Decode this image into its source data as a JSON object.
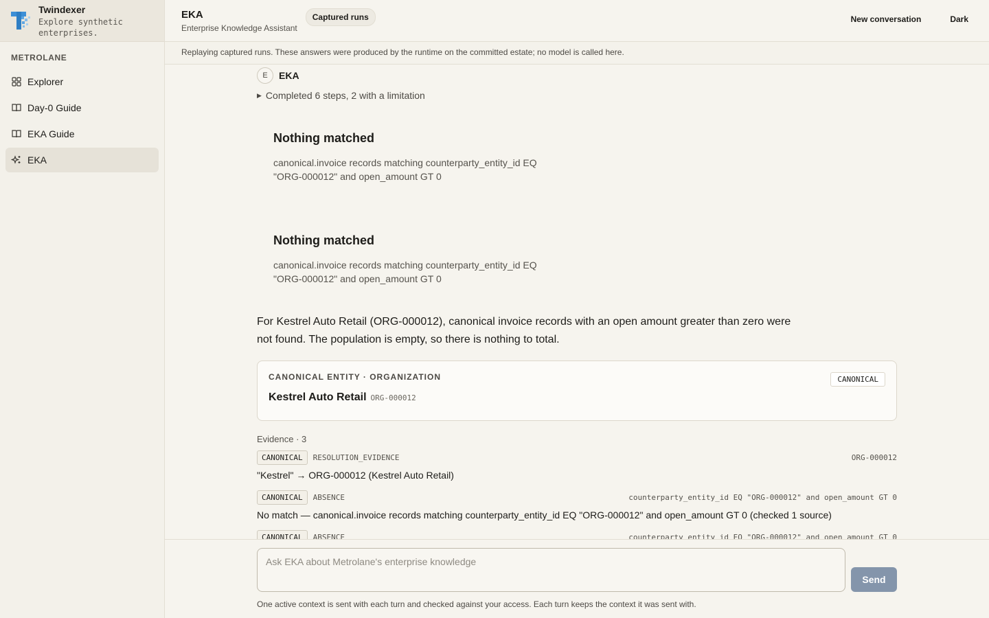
{
  "brand": {
    "name": "Twindexer",
    "tagline": "Explore synthetic enterprises."
  },
  "sidebar": {
    "org_label": "METROLANE",
    "items": [
      {
        "label": "Explorer",
        "icon": "grid-icon"
      },
      {
        "label": "Day-0 Guide",
        "icon": "book-icon"
      },
      {
        "label": "EKA Guide",
        "icon": "book-icon"
      },
      {
        "label": "EKA",
        "icon": "sparkle-icon",
        "active": true
      }
    ]
  },
  "header": {
    "title": "EKA",
    "subtitle": "Enterprise Knowledge Assistant",
    "pill": "Captured runs",
    "new_conversation": "New conversation",
    "theme_toggle": "Dark"
  },
  "notice": "Replaying captured runs. These answers were produced by the runtime on the committed estate; no model is called here.",
  "message": {
    "avatar": "E",
    "agent": "EKA",
    "steps": "Completed 6 steps, 2 with a limitation",
    "blocks": [
      {
        "title": "Nothing matched",
        "body": "canonical.invoice records matching counterparty_entity_id EQ \"ORG-000012\" and open_amount GT 0"
      },
      {
        "title": "Nothing matched",
        "body": "canonical.invoice records matching counterparty_entity_id EQ \"ORG-000012\" and open_amount GT 0"
      }
    ],
    "answer": "For Kestrel Auto Retail (ORG-000012), canonical invoice records with an open amount greater than zero were not found. The population is empty, so there is nothing to total.",
    "entity_card": {
      "eyebrow": "CANONICAL ENTITY · ORGANIZATION",
      "badge": "CANONICAL",
      "name": "Kestrel Auto Retail",
      "id": "ORG-000012"
    },
    "evidence": {
      "heading": "Evidence · 3",
      "items": [
        {
          "tag": "CANONICAL",
          "kind": "RESOLUTION_EVIDENCE",
          "ref": "ORG-000012",
          "text": "\"Kestrel\" → ORG-000012 (Kestrel Auto Retail)"
        },
        {
          "tag": "CANONICAL",
          "kind": "ABSENCE",
          "ref": "counterparty_entity_id EQ \"ORG-000012\" and open_amount GT 0",
          "text": "No match — canonical.invoice records matching counterparty_entity_id EQ \"ORG-000012\" and open_amount GT 0 (checked 1 source)"
        },
        {
          "tag": "CANONICAL",
          "kind": "ABSENCE",
          "ref": "counterparty_entity_id EQ \"ORG-000012\" and open_amount GT 0",
          "text": ""
        }
      ]
    }
  },
  "composer": {
    "placeholder": "Ask EKA about Metrolane's enterprise knowledge",
    "send_label": "Send",
    "footnote": "One active context is sent with each turn and checked against your access. Each turn keeps the context it was sent with."
  },
  "colors": {
    "accent": "#2f7fc4",
    "send_button": "#8495ab",
    "active_nav": "#e6e2d8"
  }
}
